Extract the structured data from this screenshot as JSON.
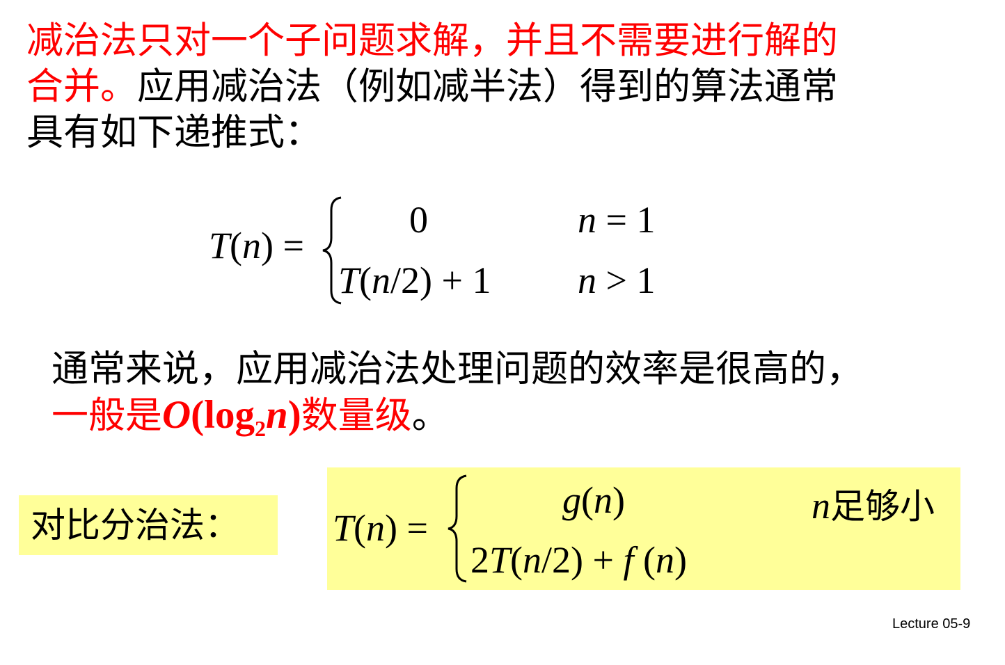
{
  "intro": {
    "highlight_text": "减治法只对一个子问题求解，并且不需要进行解的合并。",
    "highlight_line1": "减治法只对一个子问题求解，并且不需要进行解的",
    "highlight_line2": "合并。",
    "rest_line2": "应用减治法（例如减半法）得到的算法通常",
    "rest_line3": "具有如下递推式："
  },
  "formula_decrease": {
    "lhs_fn": "T",
    "lhs_arg": "(n) =",
    "case1_value": "0",
    "case1_condition": "n = 1",
    "case2_value": "T(n/2) + 1",
    "case2_condition": "n > 1"
  },
  "efficiency": {
    "line1": "通常来说，应用减治法处理问题的效率是很高的，",
    "line2_prefix": "一般是",
    "bigo_O": "O",
    "bigo_open": "(log",
    "bigo_sub": "2",
    "bigo_n": "n",
    "bigo_close": ")",
    "line2_suffix": "数量级",
    "line2_end": "。"
  },
  "contrast": {
    "label": "对比分治法："
  },
  "formula_divide": {
    "lhs_fn": "T",
    "lhs_arg": "(n) =",
    "case1_value": "g(n)",
    "case1_cond_var": "n",
    "case1_cond_text": "足够小",
    "case2_value": "2T(n/2) + f (n)"
  },
  "footer": {
    "label": "Lecture  05-9"
  },
  "colors": {
    "highlight": "#ff0000",
    "box_fill": "#ffff99",
    "text": "#000000"
  }
}
